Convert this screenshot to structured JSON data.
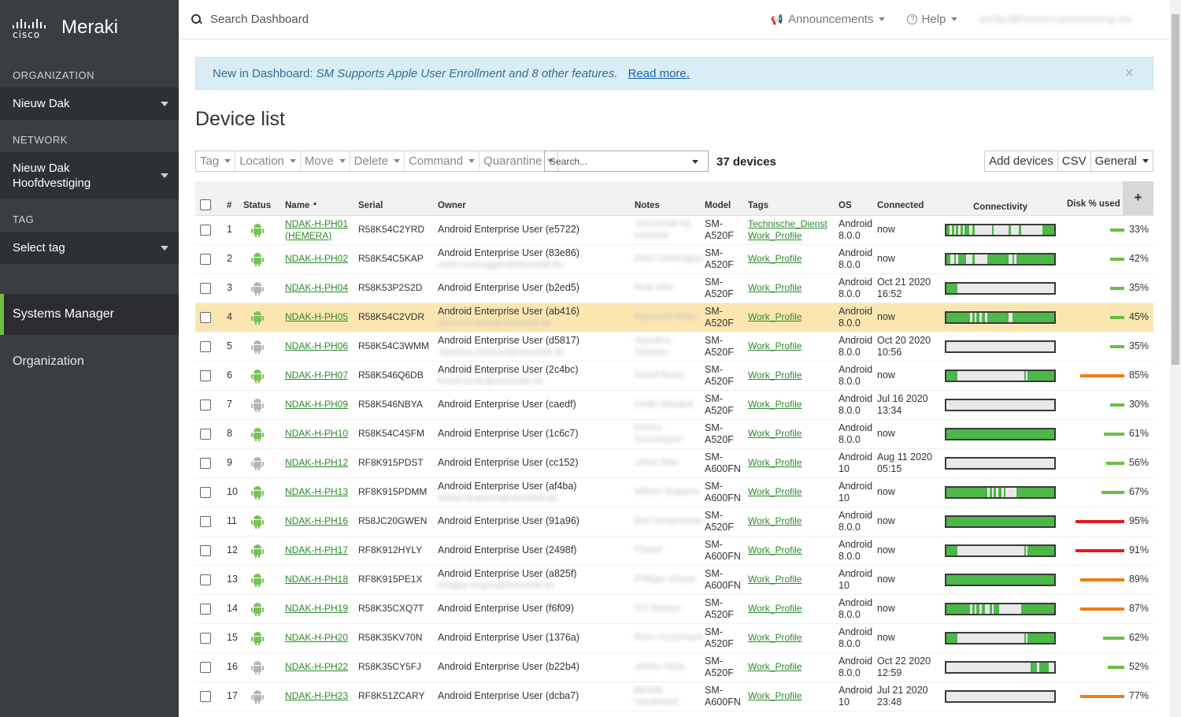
{
  "brand": {
    "cisco": "cisco",
    "product": "Meraki"
  },
  "sidebar": {
    "organization_label": "ORGANIZATION",
    "organization_value": "Nieuw Dak",
    "network_label": "NETWORK",
    "network_value": "Nieuw Dak Hoofdvestiging",
    "tag_label": "TAG",
    "tag_value": "Select tag",
    "nav_active": "Systems Manager",
    "nav_other": "Organization"
  },
  "topbar": {
    "search_placeholder": "Search Dashboard",
    "announcements": "Announcements",
    "help": "Help",
    "user": "emily@heinemannoetsing.be"
  },
  "banner": {
    "prefix": "New in Dashboard:",
    "italic": "SM Supports Apple User Enrollment and 8 other features.",
    "link": "Read more.",
    "close": "×"
  },
  "page_title": "Device list",
  "toolbar": {
    "buttons": [
      "Tag",
      "Location",
      "Move",
      "Delete",
      "Command",
      "Quarantine"
    ],
    "search_placeholder": "Search...",
    "device_count": "37 devices",
    "add_devices": "Add devices",
    "csv": "CSV",
    "general": "General"
  },
  "columns": {
    "num": "#",
    "status": "Status",
    "name": "Name",
    "serial": "Serial",
    "owner": "Owner",
    "notes": "Notes",
    "model": "Model",
    "tags": "Tags",
    "os": "OS",
    "connected": "Connected",
    "connectivity": "Connectivity",
    "disk": "Disk % used",
    "plus": "+"
  },
  "colors": {
    "online": "#78c257",
    "offline": "#b5b5b5",
    "disk_green": "#6abf3f",
    "disk_orange": "#f07c15",
    "disk_red": "#e01c1c"
  },
  "rows": [
    {
      "n": "1",
      "online": true,
      "name": "NDAK-H-PH01 (HEMERA)",
      "serial": "R58K54C2YRD",
      "owner": "Android Enterprise User (e5722)",
      "email": "",
      "notes": "Test toestel bij helpdesk",
      "model": "SM-A520F",
      "tags": [
        "Technische_Dienst",
        "Work_Profile"
      ],
      "os": "Android 8.0.0",
      "connected": "now",
      "conn": [
        [
          0,
          3
        ],
        [
          5,
          2
        ],
        [
          9,
          2
        ],
        [
          13,
          2
        ],
        [
          17,
          4
        ],
        [
          24,
          2
        ],
        [
          42,
          2
        ],
        [
          58,
          2
        ],
        [
          67,
          2
        ],
        [
          89,
          11
        ]
      ],
      "disk": 33
    },
    {
      "n": "2",
      "online": true,
      "name": "NDAK-H-PH02",
      "serial": "R58K54C5KAP",
      "owner": "Android Enterprise User (83e86)",
      "email": "mario.verbruggen@nieuwdak.be",
      "notes": "Mario Verbruggen",
      "model": "SM-A520F",
      "tags": [
        "Work_Profile"
      ],
      "os": "Android 8.0.0",
      "connected": "now",
      "conn": [
        [
          0,
          4
        ],
        [
          7,
          2
        ],
        [
          11,
          7
        ],
        [
          24,
          2
        ],
        [
          38,
          20
        ],
        [
          61,
          2
        ],
        [
          65,
          35
        ]
      ],
      "disk": 42
    },
    {
      "n": "3",
      "online": false,
      "name": "NDAK-H-PH04",
      "serial": "R58K53P2S2D",
      "owner": "Android Enterprise User (b2ed5)",
      "email": "",
      "notes": "Rudi Wille",
      "model": "SM-A520F",
      "tags": [
        "Work_Profile"
      ],
      "os": "Android 8.0.0",
      "connected": "Oct 21 2020 16:52",
      "conn": [
        [
          0,
          10
        ]
      ],
      "disk": 35
    },
    {
      "n": "4",
      "online": true,
      "name": "NDAK-H-PH05",
      "serial": "R58K54C2VDR",
      "owner": "Android Enterprise User (ab416)",
      "email": "raymond.vinke@nieuwdak.be",
      "notes": "Raymond Vinke",
      "model": "SM-A520F",
      "tags": [
        "Work_Profile"
      ],
      "os": "Android 8.0.0",
      "connected": "now",
      "conn": [
        [
          0,
          22
        ],
        [
          24,
          2
        ],
        [
          28,
          3
        ],
        [
          33,
          3
        ],
        [
          38,
          20
        ],
        [
          61,
          39
        ]
      ],
      "disk": 45
    },
    {
      "n": "5",
      "online": false,
      "name": "NDAK-H-PH06",
      "serial": "R58K54C3WMM",
      "owner": "Android Enterprise User (d5817)",
      "email": "vijandera.dutriaan@nieuwdak.be",
      "notes": "Vijandera Dutriaan",
      "model": "SM-A520F",
      "tags": [
        "Work_Profile"
      ],
      "os": "Android 8.0.0",
      "connected": "Oct 20 2020 10:56",
      "conn": [],
      "disk": 35
    },
    {
      "n": "6",
      "online": true,
      "name": "NDAK-H-PH07",
      "serial": "R58K546Q6DB",
      "owner": "Android Enterprise User (2c4bc)",
      "email": "kristof.bonte@nieuwdak.be",
      "notes": "Kristof Bonte",
      "model": "SM-A520F",
      "tags": [
        "Work_Profile"
      ],
      "os": "Android 8.0.0",
      "connected": "now",
      "conn": [
        [
          0,
          10
        ],
        [
          72,
          2
        ],
        [
          75,
          25
        ]
      ],
      "disk": 85
    },
    {
      "n": "7",
      "online": false,
      "name": "NDAK-H-PH09",
      "serial": "R58K546NBYA",
      "owner": "Android Enterprise User (caedf)",
      "email": "",
      "notes": "Guido Maagnel",
      "model": "SM-A520F",
      "tags": [
        "Work_Profile"
      ],
      "os": "Android 8.0.0",
      "connected": "Jul 16 2020 13:34",
      "conn": [],
      "disk": 30
    },
    {
      "n": "8",
      "online": true,
      "name": "NDAK-H-PH10",
      "serial": "R58K54C4SFM",
      "owner": "Android Enterprise User (1c6c7)",
      "email": "",
      "notes": "Dennis Donckerjans",
      "model": "SM-A520F",
      "tags": [
        "Work_Profile"
      ],
      "os": "Android 8.0.0",
      "connected": "now",
      "conn": [
        [
          0,
          100
        ]
      ],
      "disk": 61
    },
    {
      "n": "9",
      "online": false,
      "name": "NDAK-H-PH12",
      "serial": "RF8K915PDST",
      "owner": "Android Enterprise User (cc152)",
      "email": "",
      "notes": "Johan Mae",
      "model": "SM-A600FN",
      "tags": [
        "Work_Profile"
      ],
      "os": "Android 10",
      "connected": "Aug 11 2020 05:15",
      "conn": [],
      "disk": 56
    },
    {
      "n": "10",
      "online": true,
      "name": "NDAK-H-PH13",
      "serial": "RF8K915PDMM",
      "owner": "Android Enterprise User (af4ba)",
      "email": "william.bogaerts@nieuwdak.be",
      "notes": "William Bogaerts",
      "model": "SM-A600FN",
      "tags": [
        "Work_Profile"
      ],
      "os": "Android 10",
      "connected": "now",
      "conn": [
        [
          0,
          38
        ],
        [
          40,
          2
        ],
        [
          44,
          2
        ],
        [
          48,
          3
        ],
        [
          53,
          2
        ],
        [
          65,
          35
        ]
      ],
      "disk": 67
    },
    {
      "n": "11",
      "online": true,
      "name": "NDAK-H-PH16",
      "serial": "R58JC20GWEN",
      "owner": "Android Enterprise User (91a96)",
      "email": "",
      "notes": "Bart Vangoolwaer",
      "model": "SM-A520F",
      "tags": [
        "Work_Profile"
      ],
      "os": "Android 8.0.0",
      "connected": "now",
      "conn": [
        [
          0,
          100
        ]
      ],
      "disk": 95
    },
    {
      "n": "12",
      "online": true,
      "name": "NDAK-H-PH17",
      "serial": "RF8K912HYLY",
      "owner": "Android Enterprise User (2498f)",
      "email": "",
      "notes": "Charlie",
      "model": "SM-A600FN",
      "tags": [
        "Work_Profile"
      ],
      "os": "Android 8.0.0",
      "connected": "now",
      "conn": [
        [
          0,
          10
        ],
        [
          72,
          2
        ],
        [
          75,
          25
        ]
      ],
      "disk": 91
    },
    {
      "n": "13",
      "online": true,
      "name": "NDAK-H-PH18",
      "serial": "RF8K915PE1X",
      "owner": "Android Enterprise User (a825f)",
      "email": "philippe.vlogels@nieuwdak.be",
      "notes": "Philippe Vlogels",
      "model": "SM-A600FN",
      "tags": [
        "Work_Profile"
      ],
      "os": "Android 10",
      "connected": "now",
      "conn": [
        [
          0,
          100
        ]
      ],
      "disk": 89
    },
    {
      "n": "14",
      "online": true,
      "name": "NDAK-H-PH19",
      "serial": "R58K35CXQ7T",
      "owner": "Android Enterprise User (f6f09)",
      "email": "",
      "notes": "Kim Boeken",
      "model": "SM-A520F",
      "tags": [
        "Work_Profile"
      ],
      "os": "Android 8.0.0",
      "connected": "now",
      "conn": [
        [
          0,
          22
        ],
        [
          24,
          2
        ],
        [
          28,
          3
        ],
        [
          33,
          3
        ],
        [
          40,
          2
        ],
        [
          44,
          5
        ],
        [
          69,
          31
        ]
      ],
      "disk": 87
    },
    {
      "n": "15",
      "online": true,
      "name": "NDAK-H-PH20",
      "serial": "R58K35KV70N",
      "owner": "Android Enterprise User (1376a)",
      "email": "",
      "notes": "Boris Coucemans",
      "model": "SM-A520F",
      "tags": [
        "Work_Profile"
      ],
      "os": "Android 8.0.0",
      "connected": "now",
      "conn": [
        [
          0,
          10
        ],
        [
          72,
          2
        ],
        [
          75,
          25
        ]
      ],
      "disk": 62
    },
    {
      "n": "16",
      "online": false,
      "name": "NDAK-H-PH22",
      "serial": "R58K35CY5FJ",
      "owner": "Android Enterprise User (b22b4)",
      "email": "",
      "notes": "Jeroen Klaas",
      "model": "SM-A520F",
      "tags": [
        "Work_Profile"
      ],
      "os": "Android 8.0.0",
      "connected": "Oct 22 2020 12:59",
      "conn": [
        [
          78,
          6
        ],
        [
          86,
          9
        ]
      ],
      "disk": 52
    },
    {
      "n": "17",
      "online": false,
      "name": "NDAK-H-PH23",
      "serial": "RF8K51ZCARY",
      "owner": "Android Enterprise User (dcba7)",
      "email": "",
      "notes": "Bertold Vanderheid",
      "model": "SM-A600FN",
      "tags": [
        "Work_Profile"
      ],
      "os": "Android 10",
      "connected": "Jul 21 2020 23:48",
      "conn": [],
      "disk": 77
    }
  ]
}
